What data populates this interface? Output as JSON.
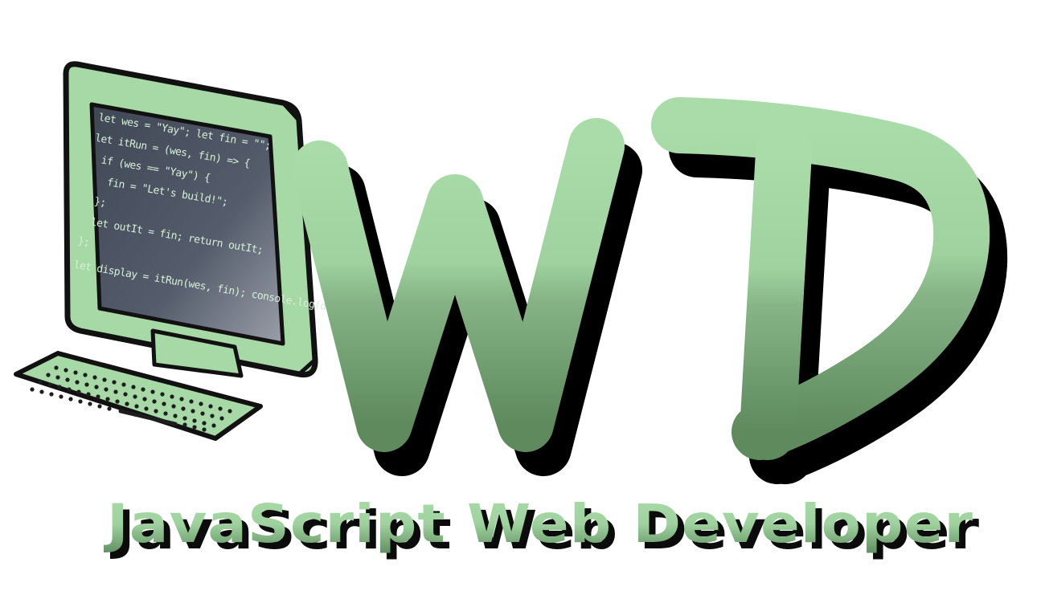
{
  "logo": {
    "monogram": "WD",
    "tagline": "JavaScript Web Developer"
  },
  "screen": {
    "code_lines": [
      "let wes = \"Yay\"; let fin = \"\";",
      "let itRun = (wes, fin) => {",
      "if (wes == \"Yay\") {",
      "fin = \"Let's build!\";",
      "};",
      "let outIt = fin; return outIt;",
      "};",
      "let display = itRun(wes, fin); console.log(display);"
    ]
  },
  "colors": {
    "green_light": "#a9dca9",
    "green_dark": "#5e8a5e",
    "outline": "#111111",
    "screen": "#4e5562"
  }
}
